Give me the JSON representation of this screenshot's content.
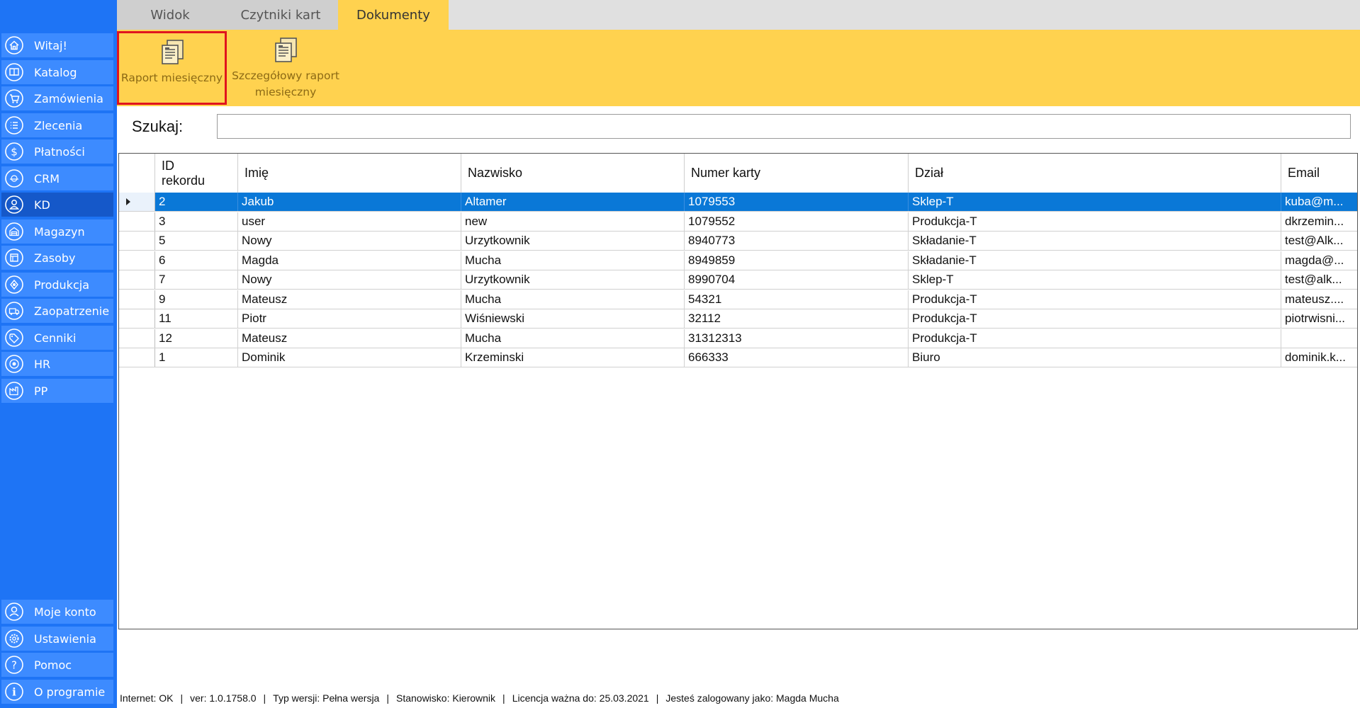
{
  "sidebar": {
    "items": [
      {
        "label": "Witaj!",
        "icon": "home-icon"
      },
      {
        "label": "Katalog",
        "icon": "book-icon"
      },
      {
        "label": "Zamówienia",
        "icon": "cart-icon"
      },
      {
        "label": "Zlecenia",
        "icon": "list-icon"
      },
      {
        "label": "Płatności",
        "icon": "dollar-icon"
      },
      {
        "label": "CRM",
        "icon": "crm-icon"
      },
      {
        "label": "KD",
        "icon": "user-icon"
      },
      {
        "label": "Magazyn",
        "icon": "warehouse-icon"
      },
      {
        "label": "Zasoby",
        "icon": "resources-icon"
      },
      {
        "label": "Produkcja",
        "icon": "production-icon"
      },
      {
        "label": "Zaopatrzenie",
        "icon": "truck-icon"
      },
      {
        "label": "Cenniki",
        "icon": "tag-icon"
      },
      {
        "label": "HR",
        "icon": "hr-icon"
      },
      {
        "label": "PP",
        "icon": "factory-icon"
      }
    ],
    "bottom_items": [
      {
        "label": "Moje konto",
        "icon": "account-icon"
      },
      {
        "label": "Ustawienia",
        "icon": "gear-icon"
      },
      {
        "label": "Pomoc",
        "icon": "help-icon"
      },
      {
        "label": "O programie",
        "icon": "info-icon"
      }
    ],
    "active": "KD"
  },
  "tabs": [
    {
      "label": "Widok"
    },
    {
      "label": "Czytniki kart"
    },
    {
      "label": "Dokumenty"
    }
  ],
  "active_tab": "Dokumenty",
  "ribbon": {
    "buttons": [
      {
        "label": "Raport miesięczny",
        "icon": "document-report-icon"
      },
      {
        "label_line1": "Szczegółowy raport",
        "label_line2": "miesięczny",
        "icon": "document-report-icon"
      }
    ]
  },
  "search": {
    "label": "Szukaj:",
    "value": ""
  },
  "table": {
    "headers": [
      {
        "line1": "ID",
        "line2": "rekordu"
      },
      {
        "line1": "Imię"
      },
      {
        "line1": "Nazwisko"
      },
      {
        "line1": "Numer karty"
      },
      {
        "line1": "Dział"
      },
      {
        "line1": "Email"
      }
    ],
    "rows": [
      {
        "id": "2",
        "imie": "Jakub",
        "nazwisko": "Altamer",
        "karta": "1079553",
        "dzial": "Sklep-T",
        "email": "kuba@m..."
      },
      {
        "id": "3",
        "imie": "user",
        "nazwisko": "new",
        "karta": "1079552",
        "dzial": "Produkcja-T",
        "email": "dkrzemin..."
      },
      {
        "id": "5",
        "imie": "Nowy",
        "nazwisko": "Urzytkownik",
        "karta": "8940773",
        "dzial": "Składanie-T",
        "email": "test@Alk..."
      },
      {
        "id": "6",
        "imie": "Magda",
        "nazwisko": "Mucha",
        "karta": "8949859",
        "dzial": "Składanie-T",
        "email": "magda@..."
      },
      {
        "id": "7",
        "imie": "Nowy",
        "nazwisko": "Urzytkownik",
        "karta": "8990704",
        "dzial": "Sklep-T",
        "email": "test@alk..."
      },
      {
        "id": "9",
        "imie": "Mateusz",
        "nazwisko": "Mucha",
        "karta": "54321",
        "dzial": "Produkcja-T",
        "email": "mateusz...."
      },
      {
        "id": "11",
        "imie": "Piotr",
        "nazwisko": "Wiśniewski",
        "karta": "32112",
        "dzial": "Produkcja-T",
        "email": "piotrwisni..."
      },
      {
        "id": "12",
        "imie": "Mateusz",
        "nazwisko": "Mucha",
        "karta": "31312313",
        "dzial": "Produkcja-T",
        "email": ""
      },
      {
        "id": "1",
        "imie": "Dominik",
        "nazwisko": "Krzeminski",
        "karta": "666333",
        "dzial": "Biuro",
        "email": "dominik.k..."
      }
    ],
    "selected_row": 0
  },
  "statusbar": {
    "internet": "Internet: OK",
    "version": "ver: 1.0.1758.0",
    "type": "Typ wersji: Pełna wersja",
    "position": "Stanowisko: Kierownik",
    "license": "Licencja ważna do: 25.03.2021",
    "user": "Jesteś zalogowany jako: Magda Mucha"
  },
  "colors": {
    "sidebar": "#1e74f5",
    "nav_item": "#3d8bff",
    "ribbon": "#ffd24f",
    "selection": "#0a78d7",
    "highlight_border": "#e0141e"
  }
}
